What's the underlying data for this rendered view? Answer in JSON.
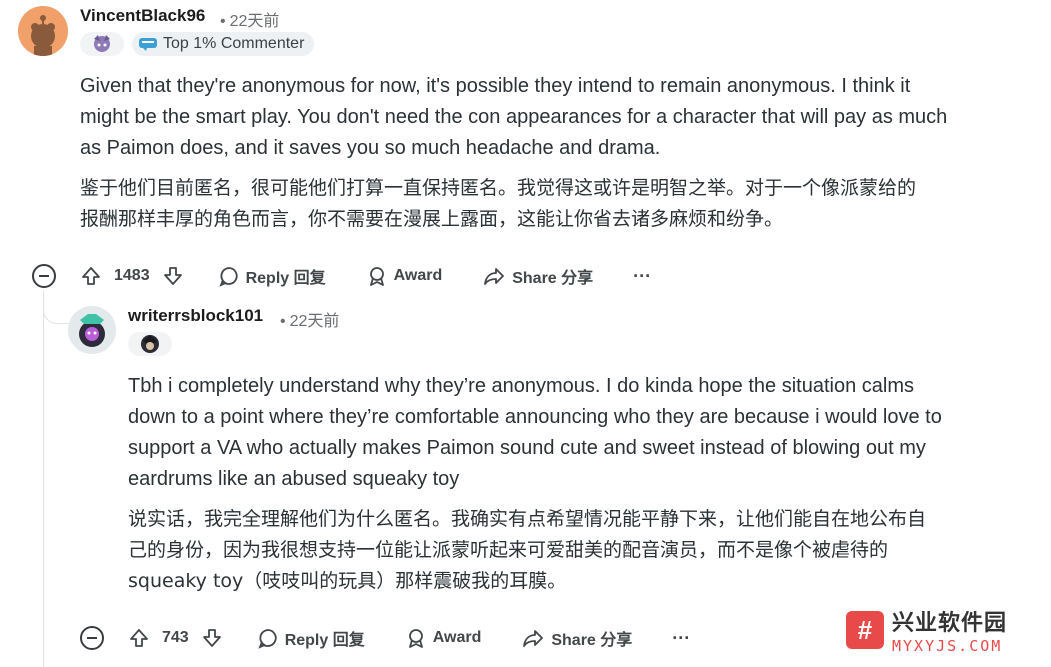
{
  "comments": [
    {
      "author": "VincentBlack96",
      "time": "22天前",
      "flair": "Top 1% Commenter",
      "body_en": [
        "Given that they're anonymous for now, it's possible they intend to remain anonymous. I think it",
        "might be the smart play. You don't need the con appearances for a character that will pay as much",
        "as Paimon does, and it saves you so much headache and drama."
      ],
      "body_cn": [
        "鉴于他们目前匿名，很可能他们打算一直保持匿名。我觉得这或许是明智之举。对于一个像派蒙给的",
        "报酬那样丰厚的角色而言，你不需要在漫展上露面，这能让你省去诸多麻烦和纷争。"
      ],
      "votes": "1483",
      "reply_label": "Reply 回复",
      "award_label": "Award",
      "share_label": "Share 分享",
      "more_label": "···"
    },
    {
      "author": "writerrsblock101",
      "time": "22天前",
      "body_en": [
        "Tbh i completely understand why they’re anonymous. I do kinda hope the situation calms",
        "down to a point where they’re comfortable announcing who they are because i would love to",
        "support a VA who actually makes Paimon sound cute and sweet instead of blowing out my",
        "eardrums like an abused squeaky toy"
      ],
      "body_cn": [
        "说实话，我完全理解他们为什么匿名。我确实有点希望情况能平静下来，让他们能自在地公布自",
        "己的身份，因为我很想支持一位能让派蒙听起来可爱甜美的配音演员，而不是像个被虐待的",
        "squeaky toy（吱吱叫的玩具）那样震破我的耳膜。"
      ],
      "votes": "743",
      "reply_label": "Reply 回复",
      "award_label": "Award",
      "share_label": "Share 分享",
      "more_label": "···"
    }
  ],
  "watermark": {
    "logo": "#",
    "cn": "兴业软件园",
    "en": "MYXYJS.COM"
  },
  "colors": {
    "accent": "#e84a4a",
    "text": "#2a3236",
    "muted": "#6a6e71"
  }
}
